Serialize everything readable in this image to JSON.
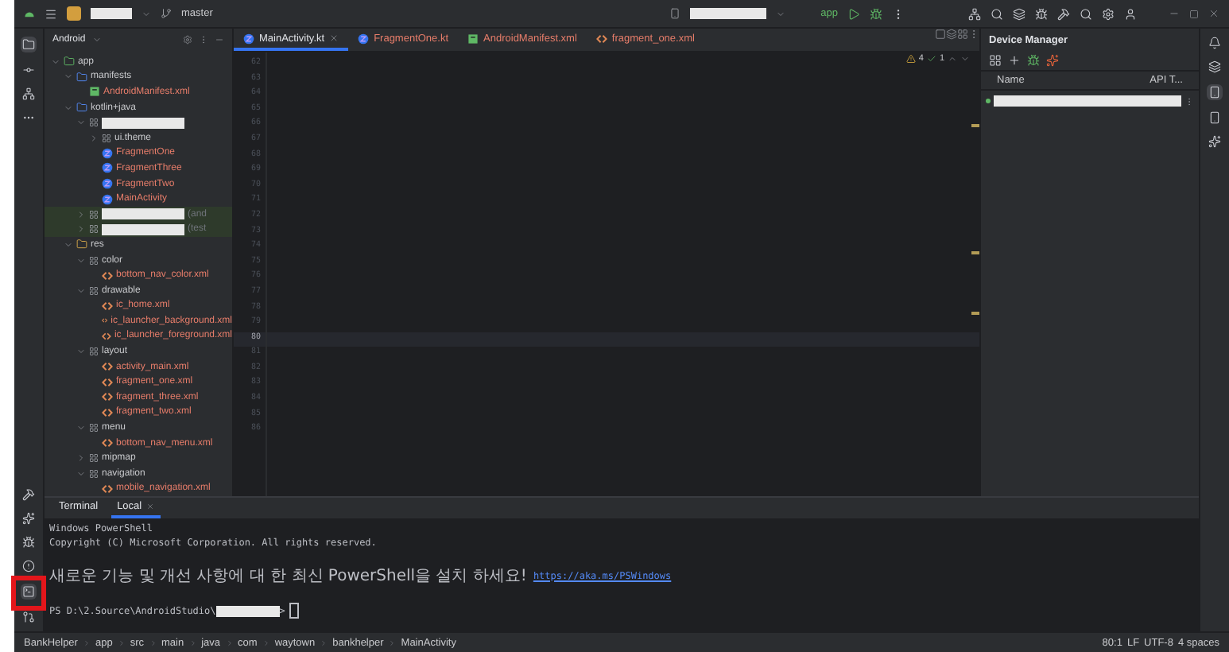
{
  "top_bar": {
    "project_redacted": true,
    "branch": "master",
    "device_redacted": true,
    "run_config": "app"
  },
  "project_panel": {
    "view": "Android",
    "tree": [
      {
        "kind": "module",
        "label": "app",
        "expanded": true,
        "children": [
          {
            "kind": "folder",
            "label": "manifests",
            "expanded": true,
            "children": [
              {
                "kind": "manifest",
                "label": "AndroidManifest.xml"
              }
            ]
          },
          {
            "kind": "folder",
            "label": "kotlin+java",
            "expanded": true,
            "children": [
              {
                "kind": "package",
                "redacted": true,
                "expanded": true,
                "children": [
                  {
                    "kind": "package",
                    "label": "ui.theme",
                    "expanded": false
                  },
                  {
                    "kind": "kotlin",
                    "label": "FragmentOne"
                  },
                  {
                    "kind": "kotlin",
                    "label": "FragmentThree"
                  },
                  {
                    "kind": "kotlin",
                    "label": "FragmentTwo"
                  },
                  {
                    "kind": "kotlin",
                    "label": "MainActivity"
                  }
                ]
              },
              {
                "kind": "test-package",
                "redacted": true,
                "suffix": "(and",
                "expanded": false
              },
              {
                "kind": "test-package",
                "redacted": true,
                "suffix": "(test",
                "expanded": false
              }
            ]
          },
          {
            "kind": "res",
            "label": "res",
            "expanded": true,
            "children": [
              {
                "kind": "package",
                "label": "color",
                "expanded": true,
                "children": [
                  {
                    "kind": "xml",
                    "label": "bottom_nav_color.xml"
                  }
                ]
              },
              {
                "kind": "package",
                "label": "drawable",
                "expanded": true,
                "children": [
                  {
                    "kind": "xml",
                    "label": "ic_home.xml"
                  },
                  {
                    "kind": "xml",
                    "label": "ic_launcher_background.xml"
                  },
                  {
                    "kind": "xml",
                    "label": "ic_launcher_foreground.xml"
                  }
                ]
              },
              {
                "kind": "package",
                "label": "layout",
                "expanded": true,
                "children": [
                  {
                    "kind": "xml",
                    "label": "activity_main.xml"
                  },
                  {
                    "kind": "xml",
                    "label": "fragment_one.xml"
                  },
                  {
                    "kind": "xml",
                    "label": "fragment_three.xml"
                  },
                  {
                    "kind": "xml",
                    "label": "fragment_two.xml"
                  }
                ]
              },
              {
                "kind": "package",
                "label": "menu",
                "expanded": true,
                "children": [
                  {
                    "kind": "xml",
                    "label": "bottom_nav_menu.xml"
                  }
                ]
              },
              {
                "kind": "package",
                "label": "mipmap",
                "expanded": false
              },
              {
                "kind": "package",
                "label": "navigation",
                "expanded": true,
                "children": [
                  {
                    "kind": "xml",
                    "label": "mobile_navigation.xml"
                  }
                ]
              }
            ]
          }
        ]
      }
    ]
  },
  "editor_tabs": [
    {
      "kind": "kotlin",
      "label": "MainActivity.kt",
      "selected": true
    },
    {
      "kind": "kotlin",
      "label": "FragmentOne.kt",
      "selected": false
    },
    {
      "kind": "manifest",
      "label": "AndroidManifest.xml",
      "selected": false
    },
    {
      "kind": "xml",
      "label": "fragment_one.xml",
      "selected": false
    }
  ],
  "editor": {
    "warnings": "4",
    "checks": "1",
    "lines": [
      {
        "number": "62",
        "current": false
      },
      {
        "number": "63",
        "current": false
      },
      {
        "number": "64",
        "current": false
      },
      {
        "number": "65",
        "current": false
      },
      {
        "number": "66",
        "current": false
      },
      {
        "number": "67",
        "current": false
      },
      {
        "number": "68",
        "current": false
      },
      {
        "number": "69",
        "current": false
      },
      {
        "number": "70",
        "current": false
      },
      {
        "number": "71",
        "current": false
      },
      {
        "number": "72",
        "current": false
      },
      {
        "number": "73",
        "current": false
      },
      {
        "number": "74",
        "current": false
      },
      {
        "number": "75",
        "current": false
      },
      {
        "number": "76",
        "current": false
      },
      {
        "number": "77",
        "current": false
      },
      {
        "number": "78",
        "current": false
      },
      {
        "number": "79",
        "current": false
      },
      {
        "number": "80",
        "current": true
      },
      {
        "number": "81",
        "current": false
      },
      {
        "number": "82",
        "current": false
      },
      {
        "number": "83",
        "current": false
      },
      {
        "number": "84",
        "current": false
      },
      {
        "number": "85",
        "current": false
      },
      {
        "number": "86",
        "current": false
      }
    ]
  },
  "device_manager": {
    "title": "Device Manager",
    "columns": [
      "Name",
      "API T..."
    ],
    "devices": [
      {
        "redacted": true,
        "online": true
      }
    ]
  },
  "terminal": {
    "title": "Terminal",
    "tabs": [
      {
        "label": "Local",
        "selected": true
      }
    ],
    "lines": [
      {
        "kind": "text",
        "text": "Windows PowerShell"
      },
      {
        "kind": "text",
        "text": "Copyright (C) Microsoft Corporation. All rights reserved."
      },
      {
        "kind": "blank"
      },
      {
        "kind": "notice",
        "text": "새로운 기능 및 개선 사항에 대 한 최신 PowerShell을 설치 하세요!",
        "link": "https://aka.ms/PSWindows"
      },
      {
        "kind": "blank"
      },
      {
        "kind": "prompt",
        "text": "PS D:\\2.Source\\AndroidStudio\\",
        "redacted": true,
        "end": ">"
      }
    ]
  },
  "breadcrumbs": [
    "BankHelper",
    "app",
    "src",
    "main",
    "java",
    "com",
    "waytown",
    "bankhelper",
    "MainActivity"
  ],
  "status": {
    "position": "80:1",
    "line_ending": "LF",
    "encoding": "UTF-8",
    "indent": "4 spaces"
  }
}
